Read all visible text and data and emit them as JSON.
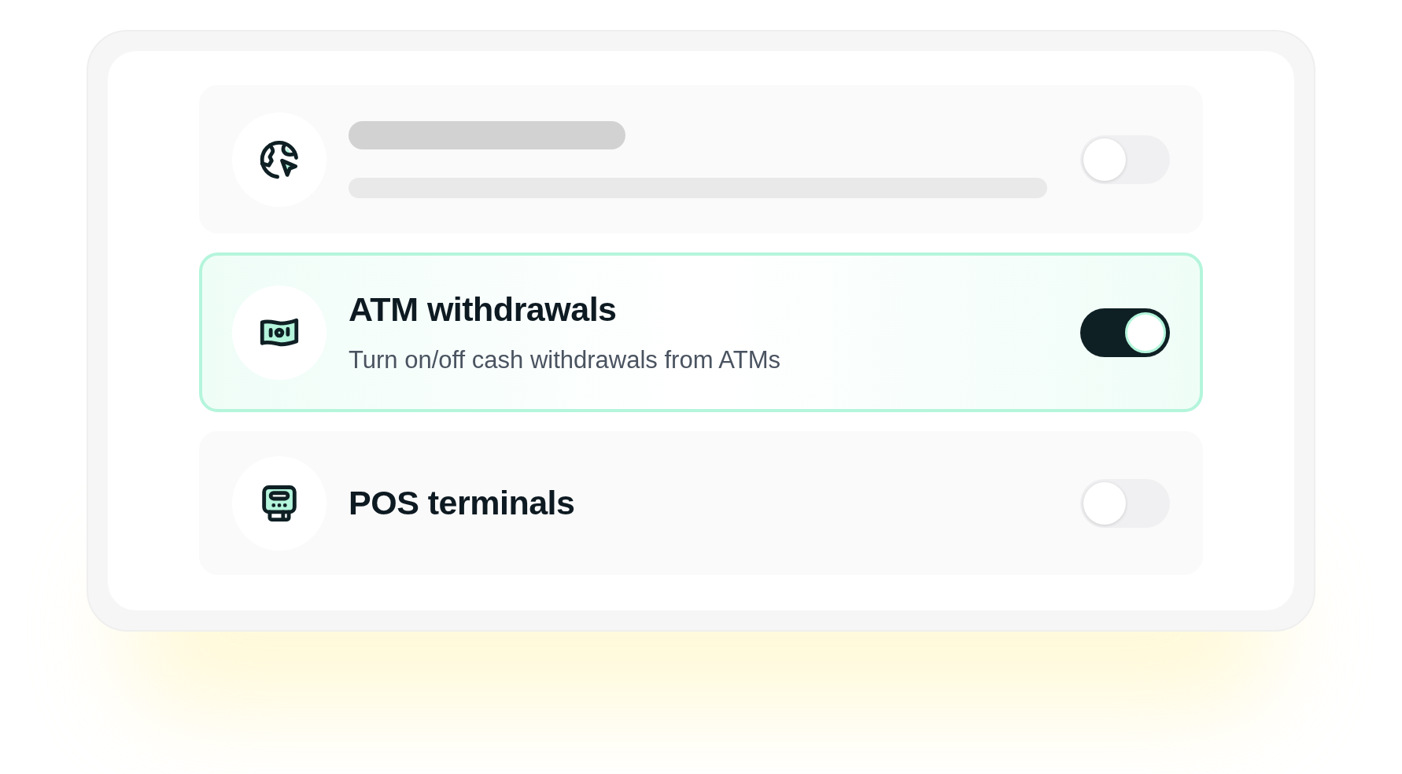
{
  "settings": [
    {
      "kind": "skeleton",
      "selected": false,
      "on": false
    },
    {
      "kind": "setting",
      "title": "ATM withdrawals",
      "description": "Turn on/off cash withdrawals from ATMs",
      "selected": true,
      "on": true
    },
    {
      "kind": "setting",
      "title": "POS terminals",
      "selected": false,
      "on": false
    }
  ]
}
